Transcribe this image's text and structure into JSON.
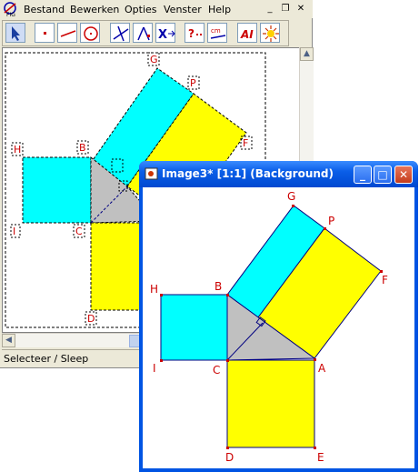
{
  "main_window": {
    "menu": [
      "Bestand",
      "Bewerken",
      "Opties",
      "Venster",
      "Help"
    ],
    "mdi_controls": [
      "_",
      "❐",
      "✕"
    ],
    "status": "Selecteer / Sleep",
    "toolbar_tools": [
      "select-tool",
      "point-tool",
      "line-tool",
      "circle-tool",
      "perpendicular-tool",
      "intersection-tool",
      "transform-tool",
      "measure-tool",
      "distance-tool",
      "text-tool",
      "color-tool"
    ]
  },
  "image_window": {
    "title": "Image3* [1:1] (Background)",
    "controls": [
      "_",
      "□",
      "✕"
    ]
  },
  "figure": {
    "labels": {
      "G": "G",
      "P": "P",
      "F": "F",
      "H": "H",
      "B": "B",
      "I": "I",
      "C": "C",
      "A": "A",
      "D": "D",
      "E": "E"
    },
    "colors": {
      "square_cyan": "#00ffff",
      "square_yellow": "#ffff00",
      "triangle": "#c0c0c0",
      "label": "#cc0000",
      "edge": "#000080"
    }
  }
}
